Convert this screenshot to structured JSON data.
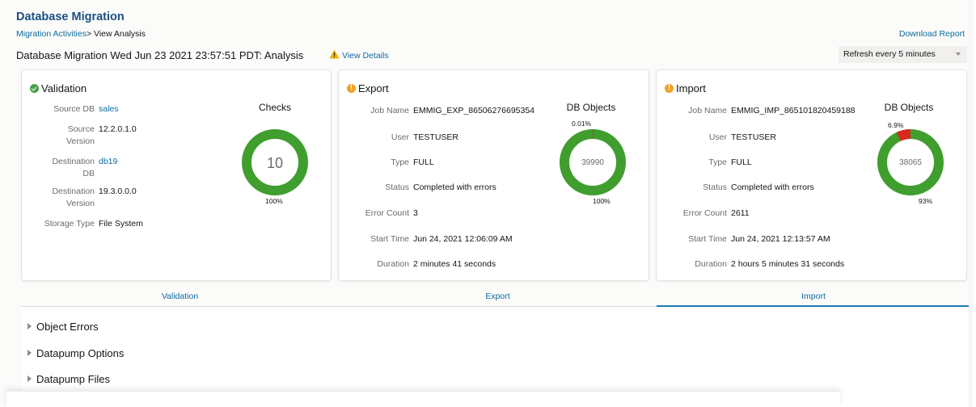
{
  "header": {
    "title": "Database Migration",
    "breadcrumb_link": "Migration Activities",
    "breadcrumb_sep": ">",
    "breadcrumb_current": " View Analysis",
    "download": "Download Report",
    "heading": "Database Migration Wed Jun 23 2021 23:57:51 PDT: Analysis",
    "view_details": "View Details",
    "refresh": "Refresh every 5 minutes"
  },
  "validation": {
    "title": "Validation",
    "rows": [
      {
        "label": "Source DB",
        "value": "sales",
        "link": true
      },
      {
        "label": "Source Version",
        "value": "12.2.0.1.0",
        "link": false
      },
      {
        "label": "Destination DB",
        "value": "db19",
        "link": true
      },
      {
        "label": "Destination Version",
        "value": "19.3.0.0.0",
        "link": false
      },
      {
        "label": "Storage Type",
        "value": "File System",
        "link": false
      }
    ],
    "donut": {
      "title": "Checks",
      "center": "10",
      "bottom_pct": "100%"
    }
  },
  "export": {
    "title": "Export",
    "rows": [
      {
        "label": "Job Name",
        "value": "EMMIG_EXP_86506276695354"
      },
      {
        "label": "User",
        "value": "TESTUSER"
      },
      {
        "label": "Type",
        "value": "FULL"
      },
      {
        "label": "Status",
        "value": "Completed with errors"
      },
      {
        "label": "Error Count",
        "value": "3"
      },
      {
        "label": "Start Time",
        "value": "Jun 24, 2021 12:06:09 AM"
      },
      {
        "label": "Duration",
        "value": "2 minutes 41 seconds"
      }
    ],
    "donut": {
      "title": "DB Objects",
      "center": "39990",
      "top_pct": "0.01%",
      "bottom_pct": "100%",
      "error_fraction": 0.0001
    }
  },
  "import": {
    "title": "Import",
    "rows": [
      {
        "label": "Job Name",
        "value": "EMMIG_IMP_865101820459188"
      },
      {
        "label": "User",
        "value": "TESTUSER"
      },
      {
        "label": "Type",
        "value": "FULL"
      },
      {
        "label": "Status",
        "value": "Completed with errors"
      },
      {
        "label": "Error Count",
        "value": "2611"
      },
      {
        "label": "Start Time",
        "value": "Jun 24, 2021 12:13:57 AM"
      },
      {
        "label": "Duration",
        "value": "2 hours 5 minutes 31 seconds"
      }
    ],
    "donut": {
      "title": "DB Objects",
      "center": "38065",
      "top_pct": "6.9%",
      "bottom_pct": "93%",
      "error_fraction": 0.069
    }
  },
  "tabs": [
    "Validation",
    "Export",
    "Import"
  ],
  "active_tab": "Import",
  "sections": [
    "Object Errors",
    "Datapump Options",
    "Datapump Files"
  ],
  "colors": {
    "success": "#3f9e2e",
    "error": "#d9291c",
    "link": "#0d6b9e",
    "title": "#1c4f82"
  }
}
